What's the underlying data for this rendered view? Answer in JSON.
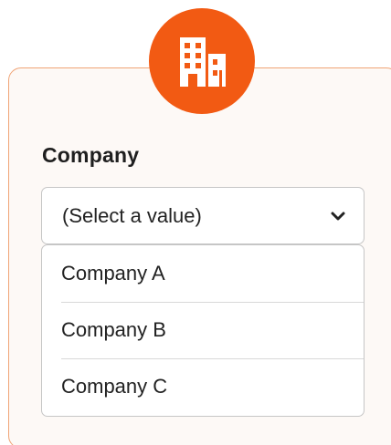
{
  "badge": {
    "icon": "building-icon",
    "color": "#f25a13"
  },
  "field": {
    "label": "Company",
    "selected_value": "(Select a value)",
    "chevron_icon": "chevron-down-icon"
  },
  "options": [
    {
      "label": "Company A"
    },
    {
      "label": "Company B"
    },
    {
      "label": "Company C"
    }
  ],
  "colors": {
    "accent": "#f25a13",
    "card_border": "#f0a476",
    "card_background": "#fdf9f6"
  }
}
